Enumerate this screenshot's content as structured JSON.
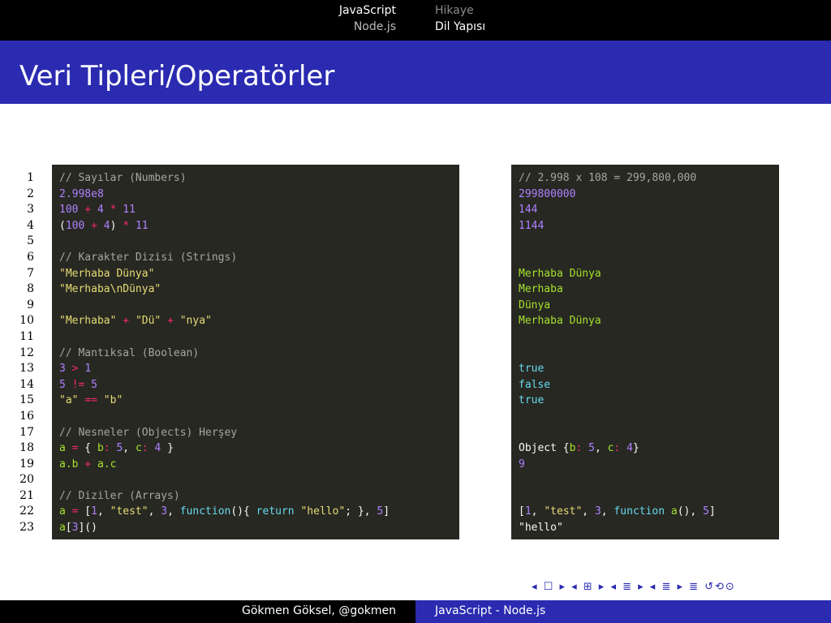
{
  "header": {
    "left_line1": "JavaScript",
    "left_line2": "Node.js",
    "right_line1": "Hikaye",
    "right_line2": "Dil Yapısı"
  },
  "title": "Veri Tipleri/Operatörler",
  "line_numbers": [
    "1",
    "2",
    "3",
    "4",
    "5",
    "6",
    "7",
    "8",
    "9",
    "10",
    "11",
    "12",
    "13",
    "14",
    "15",
    "16",
    "17",
    "18",
    "19",
    "20",
    "21",
    "22",
    "23"
  ],
  "code_left": [
    [
      [
        "c",
        "// Sayılar (Numbers)"
      ]
    ],
    [
      [
        "n",
        "2.998e8"
      ]
    ],
    [
      [
        "n",
        "100"
      ],
      [
        "w",
        " "
      ],
      [
        "o",
        "+"
      ],
      [
        "w",
        " "
      ],
      [
        "n",
        "4"
      ],
      [
        "w",
        " "
      ],
      [
        "o",
        "*"
      ],
      [
        "w",
        " "
      ],
      [
        "n",
        "11"
      ]
    ],
    [
      [
        "w",
        "("
      ],
      [
        "n",
        "100"
      ],
      [
        "w",
        " "
      ],
      [
        "o",
        "+"
      ],
      [
        "w",
        " "
      ],
      [
        "n",
        "4"
      ],
      [
        "w",
        ") "
      ],
      [
        "o",
        "*"
      ],
      [
        "w",
        " "
      ],
      [
        "n",
        "11"
      ]
    ],
    [],
    [
      [
        "c",
        "// Karakter Dizisi (Strings)"
      ]
    ],
    [
      [
        "s",
        "\"Merhaba Dünya\""
      ]
    ],
    [
      [
        "s",
        "\"Merhaba\\nDünya\""
      ]
    ],
    [],
    [
      [
        "s",
        "\"Merhaba\""
      ],
      [
        "w",
        " "
      ],
      [
        "o",
        "+"
      ],
      [
        "w",
        " "
      ],
      [
        "s",
        "\"Dü\""
      ],
      [
        "w",
        " "
      ],
      [
        "o",
        "+"
      ],
      [
        "w",
        " "
      ],
      [
        "s",
        "\"nya\""
      ]
    ],
    [],
    [
      [
        "c",
        "// Mantıksal (Boolean)"
      ]
    ],
    [
      [
        "n",
        "3"
      ],
      [
        "w",
        " "
      ],
      [
        "o",
        ">"
      ],
      [
        "w",
        " "
      ],
      [
        "n",
        "1"
      ]
    ],
    [
      [
        "n",
        "5"
      ],
      [
        "w",
        " "
      ],
      [
        "o",
        "!="
      ],
      [
        "w",
        " "
      ],
      [
        "n",
        "5"
      ]
    ],
    [
      [
        "s",
        "\"a\""
      ],
      [
        "w",
        " "
      ],
      [
        "o",
        "=="
      ],
      [
        "w",
        " "
      ],
      [
        "s",
        "\"b\""
      ]
    ],
    [],
    [
      [
        "c",
        "// Nesneler (Objects) Herşey"
      ]
    ],
    [
      [
        "g",
        "a"
      ],
      [
        "w",
        " "
      ],
      [
        "o",
        "="
      ],
      [
        "w",
        " { "
      ],
      [
        "g",
        "b"
      ],
      [
        "o",
        ":"
      ],
      [
        "w",
        " "
      ],
      [
        "n",
        "5"
      ],
      [
        "w",
        ", "
      ],
      [
        "g",
        "c"
      ],
      [
        "o",
        ":"
      ],
      [
        "w",
        " "
      ],
      [
        "n",
        "4"
      ],
      [
        "w",
        " }"
      ]
    ],
    [
      [
        "g",
        "a.b"
      ],
      [
        "w",
        " "
      ],
      [
        "o",
        "+"
      ],
      [
        "w",
        " "
      ],
      [
        "g",
        "a.c"
      ]
    ],
    [],
    [
      [
        "c",
        "// Diziler (Arrays)"
      ]
    ],
    [
      [
        "g",
        "a"
      ],
      [
        "w",
        " "
      ],
      [
        "o",
        "="
      ],
      [
        "w",
        " ["
      ],
      [
        "n",
        "1"
      ],
      [
        "w",
        ", "
      ],
      [
        "s",
        "\"test\""
      ],
      [
        "w",
        ", "
      ],
      [
        "n",
        "3"
      ],
      [
        "w",
        ", "
      ],
      [
        "k",
        "function"
      ],
      [
        "w",
        "(){ "
      ],
      [
        "k",
        "return"
      ],
      [
        "w",
        " "
      ],
      [
        "s",
        "\"hello\""
      ],
      [
        "w",
        "; }, "
      ],
      [
        "n",
        "5"
      ],
      [
        "w",
        "]"
      ]
    ],
    [
      [
        "g",
        "a"
      ],
      [
        "w",
        "["
      ],
      [
        "n",
        "3"
      ],
      [
        "w",
        "]()"
      ]
    ]
  ],
  "code_right": [
    [
      [
        "c",
        "// 2.998 x 108 = 299,800,000"
      ]
    ],
    [
      [
        "n",
        "299800000"
      ]
    ],
    [
      [
        "n",
        "144"
      ]
    ],
    [
      [
        "n",
        "1144"
      ]
    ],
    [],
    [],
    [
      [
        "g",
        "Merhaba Dünya"
      ]
    ],
    [
      [
        "g",
        "Merhaba"
      ]
    ],
    [
      [
        "g",
        "Dünya"
      ]
    ],
    [
      [
        "g",
        "Merhaba Dünya"
      ]
    ],
    [],
    [],
    [
      [
        "k",
        "true"
      ]
    ],
    [
      [
        "k",
        "false"
      ]
    ],
    [
      [
        "k",
        "true"
      ]
    ],
    [],
    [],
    [
      [
        "w",
        "Object {"
      ],
      [
        "g",
        "b"
      ],
      [
        "o",
        ":"
      ],
      [
        "w",
        " "
      ],
      [
        "n",
        "5"
      ],
      [
        "w",
        ", "
      ],
      [
        "g",
        "c"
      ],
      [
        "o",
        ":"
      ],
      [
        "w",
        " "
      ],
      [
        "n",
        "4"
      ],
      [
        "w",
        "}"
      ]
    ],
    [
      [
        "n",
        "9"
      ]
    ],
    [],
    [],
    [
      [
        "w",
        "["
      ],
      [
        "n",
        "1"
      ],
      [
        "w",
        ", "
      ],
      [
        "s",
        "\"test\""
      ],
      [
        "w",
        ", "
      ],
      [
        "n",
        "3"
      ],
      [
        "w",
        ", "
      ],
      [
        "k",
        "function"
      ],
      [
        "w",
        " "
      ],
      [
        "g",
        "a"
      ],
      [
        "w",
        "(), "
      ],
      [
        "n",
        "5"
      ],
      [
        "w",
        "]"
      ]
    ],
    [
      [
        "w",
        "\"hello\""
      ]
    ]
  ],
  "nav_symbols": "◂ ☐ ▸ ◂ ⊞ ▸ ◂ ≣ ▸ ◂ ≣ ▸  ≣  ↺⟲⊙",
  "footer": {
    "left": "Gökmen Göksel, @gokmen",
    "right": "JavaScript - Node.js"
  },
  "colors": {
    "title_bar": "#2a2bb0",
    "code_bg": "#272822"
  }
}
